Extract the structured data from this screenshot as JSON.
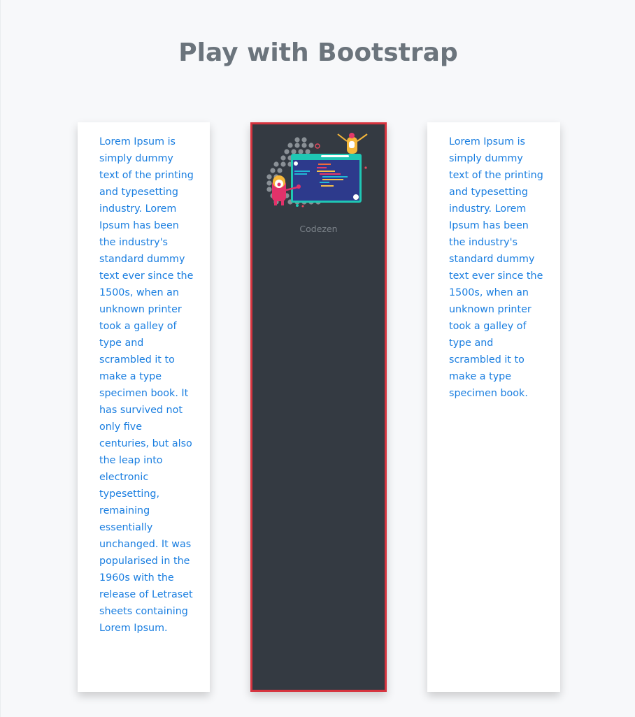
{
  "page": {
    "title": "Play with Bootstrap"
  },
  "cards": {
    "left": {
      "text": "Lorem Ipsum is simply dummy text of the printing and typesetting industry. Lorem Ipsum has been the industry's standard dummy text ever since the 1500s, when an unknown printer took a galley of type and scrambled it to make a type specimen book. It has survived not only five centuries, but also the leap into electronic typesetting, remaining essentially unchanged. It was popularised in the 1960s with the release of Letraset sheets containing Lorem Ipsum."
    },
    "middle": {
      "caption": "Codezen",
      "illustration_icon": "coding-illustration-icon"
    },
    "right": {
      "text": "Lorem Ipsum is simply dummy text of the printing and typesetting industry. Lorem Ipsum has been the industry's standard dummy text ever since the 1500s, when an unknown printer took a galley of type and scrambled it to make a type specimen book."
    }
  },
  "colors": {
    "background": "#f7f8fa",
    "title": "#6b747c",
    "link_text": "#1a7ee0",
    "dark_card": "#343a42",
    "dark_card_border": "#d6343f",
    "caption": "#7b8289"
  }
}
